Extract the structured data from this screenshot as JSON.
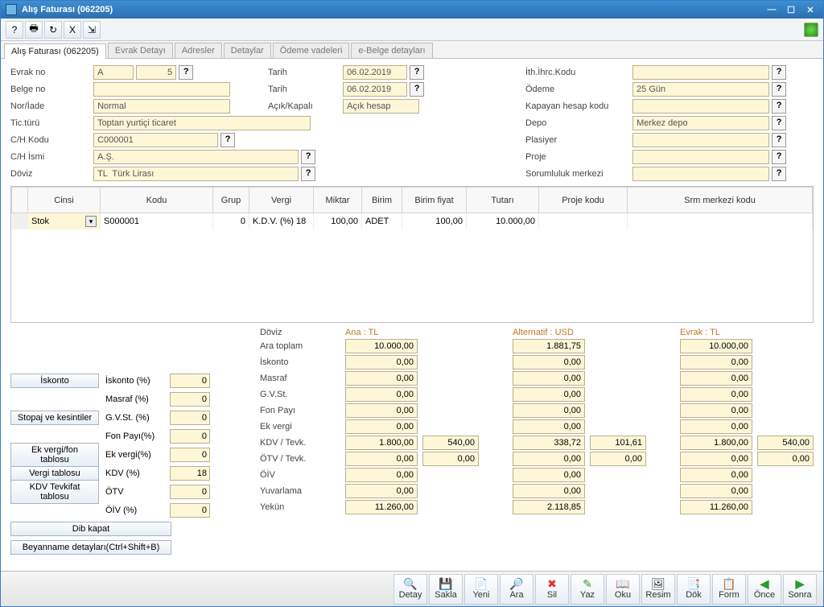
{
  "window": {
    "title": "Alış Faturası (062205)"
  },
  "tabs": [
    "Alış Faturası (062205)",
    "Evrak Detayı",
    "Adresler",
    "Detaylar",
    "Ödeme vadeleri",
    "e-Belge detayları"
  ],
  "form": {
    "evrak_no_lbl": "Evrak no",
    "evrak_no_a": "A",
    "evrak_no_n": "5",
    "belge_no_lbl": "Belge no",
    "belge_no": "",
    "nor_iade_lbl": "Nor/İade",
    "nor_iade": "Normal",
    "tic_turu_lbl": "Tic.türü",
    "tic_turu": "Toptan yurtiçi ticaret",
    "ch_kodu_lbl": "C/H Kodu",
    "ch_kodu": "C000001",
    "ch_ismi_lbl": "C/H İsmi",
    "ch_ismi": "A.Ş.",
    "doviz_lbl": "Döviz",
    "doviz": "TL  Türk Lirası",
    "tarih1_lbl": "Tarih",
    "tarih1": "06.02.2019",
    "tarih2_lbl": "Tarih",
    "tarih2": "06.02.2019",
    "acik_kapali_lbl": "Açık/Kapalı",
    "acik_kapali": "Açık hesap",
    "ith_ihrc_lbl": "İth.İhrc.Kodu",
    "ith_ihrc": "",
    "odeme_lbl": "Ödeme",
    "odeme": "25 Gün",
    "kapayan_lbl": "Kapayan hesap kodu",
    "kapayan": "",
    "depo_lbl": "Depo",
    "depo": "Merkez depo",
    "plasiyer_lbl": "Plasiyer",
    "plasiyer": "",
    "proje_lbl": "Proje",
    "proje": "",
    "sorumluluk_lbl": "Sorumluluk merkezi",
    "sorumluluk": ""
  },
  "grid": {
    "headers": [
      "Cinsi",
      "Kodu",
      "Grup",
      "Vergi",
      "Miktar",
      "Birim",
      "Birim fiyat",
      "Tutarı",
      "Proje kodu",
      "Srm merkezi kodu"
    ],
    "row": {
      "cinsi": "Stok",
      "kodu": "S000001",
      "grup": "0",
      "vergi": "K.D.V. (%) 18",
      "miktar": "100,00",
      "birim": "ADET",
      "birim_fiyat": "100,00",
      "tutar": "10.000,00",
      "proje": "",
      "srm": ""
    }
  },
  "pct": {
    "iskonto_btn": "İskonto",
    "stopaj_btn": "Stopaj ve kesintiler",
    "ekvergi_btn": "Ek vergi/fon tablosu",
    "vergi_btn": "Vergi tablosu",
    "kdvt_btn": "KDV Tevkifat tablosu",
    "dib_btn": "Dib kapat",
    "beyan_btn": "Beyanname detayları(Ctrl+Shift+B)",
    "iskonto_lbl": "İskonto (%)",
    "iskonto_v": "0",
    "masraf_lbl": "Masraf  (%)",
    "masraf_v": "0",
    "gvst_lbl": "G.V.St. (%)",
    "gvst_v": "0",
    "fon_lbl": "Fon Payı(%)",
    "fon_v": "0",
    "ekvergi_lbl": "Ek vergi(%)",
    "ekvergi_v": "0",
    "kdv_lbl": "KDV    (%)",
    "kdv_v": "18",
    "otv_lbl": "ÖTV",
    "otv_v": "0",
    "oiv_lbl": "ÖİV    (%)",
    "oiv_v": "0"
  },
  "sum": {
    "doviz_lbl": "Döviz",
    "ana": "Ana : TL",
    "alt": "Alternatif : USD",
    "evrak": "Evrak : TL",
    "rows": {
      "ara": "Ara toplam",
      "iskonto": "İskonto",
      "masraf": "Masraf",
      "gvst": "G.V.St.",
      "fon": "Fon Payı",
      "ek": "Ek vergi",
      "kdvt": "KDV / Tevk.",
      "otvt": "ÖTV / Tevk.",
      "oiv": "ÖİV",
      "yuv": "Yuvarlama",
      "yekun": "Yekün"
    },
    "vals": {
      "ara": {
        "a": "10.000,00",
        "b": "",
        "u": "1.881,75",
        "ub": "",
        "e": "10.000,00",
        "eb": ""
      },
      "isk": {
        "a": "0,00",
        "b": "",
        "u": "0,00",
        "ub": "",
        "e": "0,00",
        "eb": ""
      },
      "mas": {
        "a": "0,00",
        "b": "",
        "u": "0,00",
        "ub": "",
        "e": "0,00",
        "eb": ""
      },
      "gv": {
        "a": "0,00",
        "b": "",
        "u": "0,00",
        "ub": "",
        "e": "0,00",
        "eb": ""
      },
      "fon": {
        "a": "0,00",
        "b": "",
        "u": "0,00",
        "ub": "",
        "e": "0,00",
        "eb": ""
      },
      "ek": {
        "a": "0,00",
        "b": "",
        "u": "0,00",
        "ub": "",
        "e": "0,00",
        "eb": ""
      },
      "kdv": {
        "a": "1.800,00",
        "b": "540,00",
        "u": "338,72",
        "ub": "101,61",
        "e": "1.800,00",
        "eb": "540,00"
      },
      "otv": {
        "a": "0,00",
        "b": "0,00",
        "u": "0,00",
        "ub": "0,00",
        "e": "0,00",
        "eb": "0,00"
      },
      "oiv": {
        "a": "0,00",
        "b": "",
        "u": "0,00",
        "ub": "",
        "e": "0,00",
        "eb": ""
      },
      "yuv": {
        "a": "0,00",
        "b": "",
        "u": "0,00",
        "ub": "",
        "e": "0,00",
        "eb": ""
      },
      "yek": {
        "a": "11.260,00",
        "b": "",
        "u": "2.118,85",
        "ub": "",
        "e": "11.260,00",
        "eb": ""
      }
    }
  },
  "bottom": [
    "Detay",
    "Sakla",
    "Yeni",
    "Ara",
    "Sil",
    "Yaz",
    "Oku",
    "Resim",
    "Dök",
    "Form",
    "Önce",
    "Sonra"
  ],
  "bottom_icons": [
    "🔍",
    "💾",
    "📄",
    "🔎",
    "✖",
    "✎",
    "📖",
    "🖼",
    "📑",
    "📋",
    "◀",
    "▶"
  ]
}
